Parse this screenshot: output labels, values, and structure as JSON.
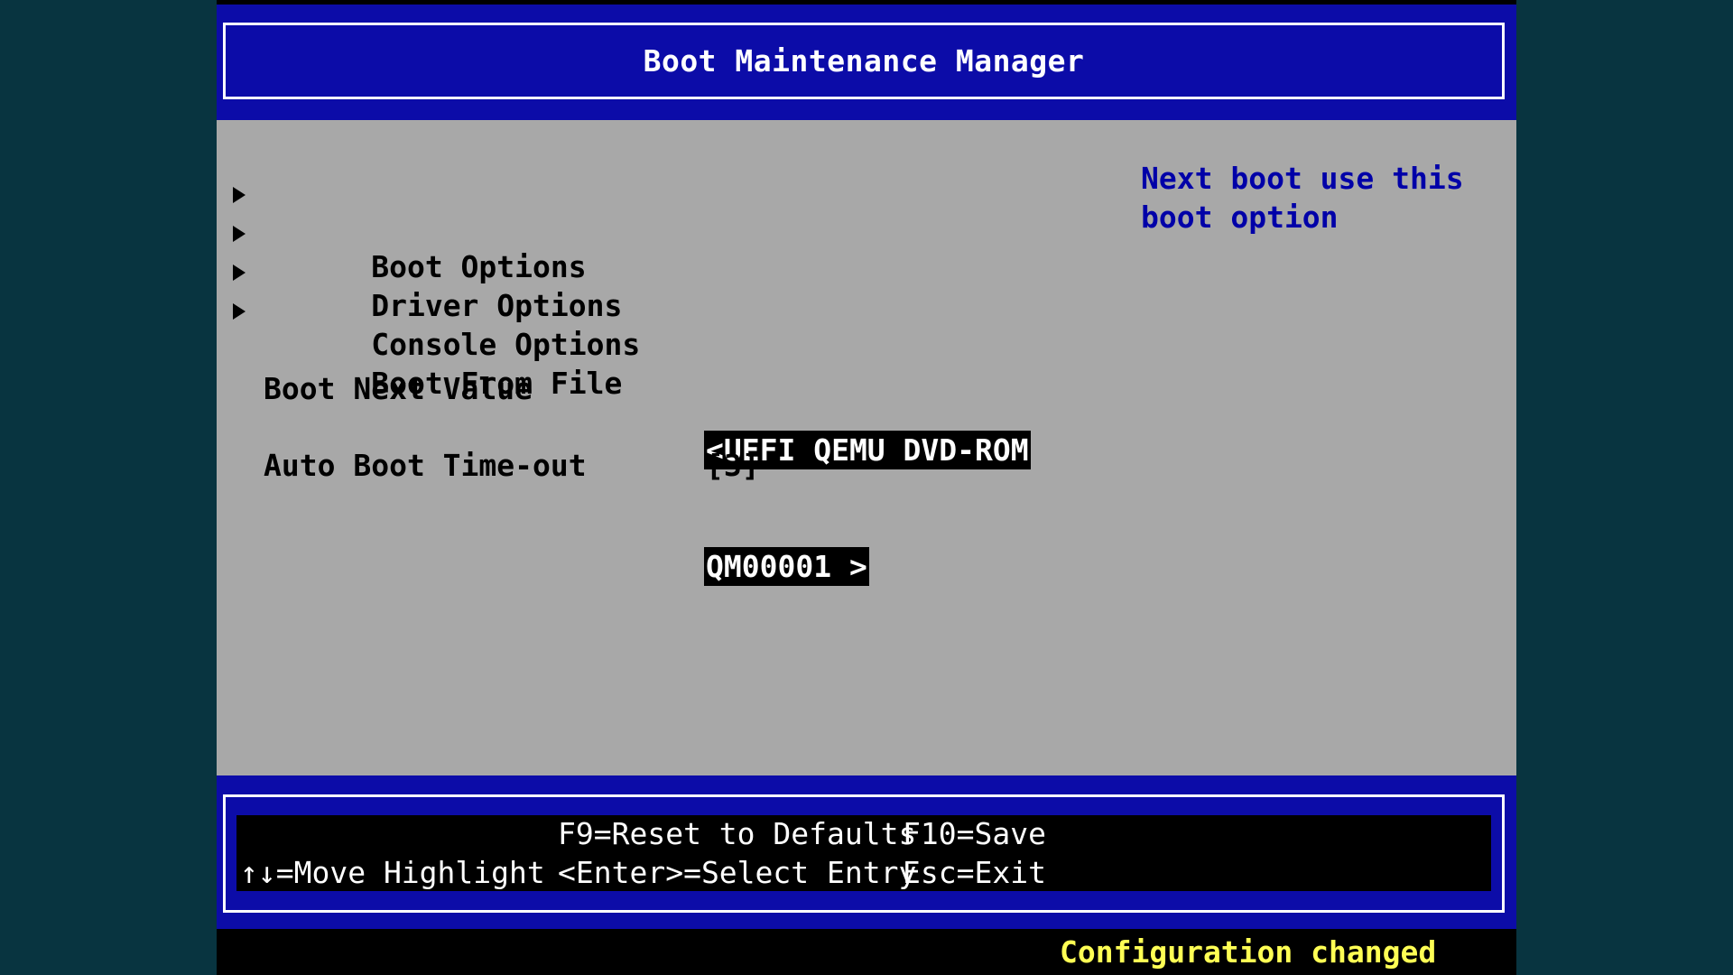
{
  "header": {
    "title": "Boot Maintenance Manager"
  },
  "menu": {
    "items": [
      {
        "label": "Boot Options"
      },
      {
        "label": "Driver Options"
      },
      {
        "label": "Console Options"
      },
      {
        "label": "Boot From File"
      }
    ]
  },
  "fields": {
    "boot_next": {
      "label": "Boot Next Value",
      "value_line1": "<UEFI QEMU DVD-ROM",
      "value_line2": "QM00001 >"
    },
    "auto_boot": {
      "label": "Auto Boot Time-out",
      "value": "[3]"
    }
  },
  "help": {
    "text": "Next boot use this boot option"
  },
  "footer": {
    "move_highlight": "↑↓=Move Highlight",
    "reset_defaults": "F9=Reset to Defaults",
    "select_entry": "<Enter>=Select Entry",
    "save": "F10=Save",
    "exit": "Esc=Exit"
  },
  "status": {
    "message": "Configuration changed"
  },
  "colors": {
    "background": "#083440",
    "header_blue": "#0c0ca8",
    "panel_gray": "#a8a8a8",
    "help_blue": "#0000a8",
    "status_yellow": "#ffff54"
  },
  "icons": {
    "submenu": "triangle-right-icon"
  }
}
